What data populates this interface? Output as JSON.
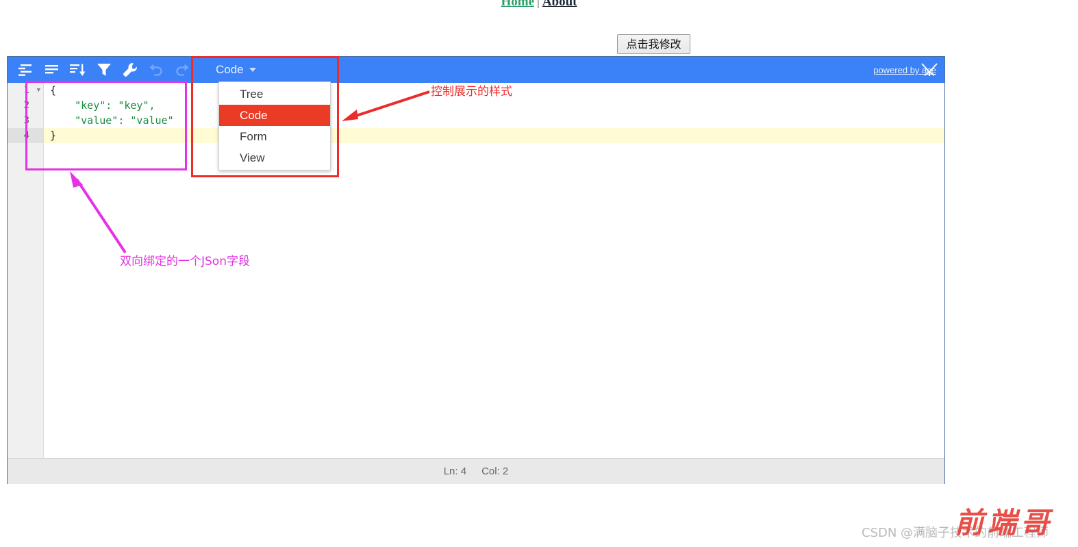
{
  "page_nav": {
    "home_label": "Home",
    "separator": "|",
    "about_label": "About",
    "home_color": "#2e9e6b",
    "about_color": "#1b2733"
  },
  "modify_button": {
    "label": "点击我修改"
  },
  "editor": {
    "toolbar": {
      "background_color": "#3b81f7",
      "buttons": [
        {
          "name": "expand-all-icon",
          "title": "Expand all"
        },
        {
          "name": "collapse-all-icon",
          "title": "Collapse all"
        },
        {
          "name": "sort-icon",
          "title": "Sort"
        },
        {
          "name": "filter-icon",
          "title": "Filter"
        },
        {
          "name": "transform-wrench-icon",
          "title": "Transform"
        },
        {
          "name": "undo-icon",
          "title": "Undo",
          "disabled": true
        },
        {
          "name": "redo-icon",
          "title": "Redo",
          "disabled": true
        }
      ],
      "mode_selector": {
        "current": "Code",
        "caret_icon": "chevron-down-icon",
        "options": [
          "Tree",
          "Code",
          "Form",
          "View"
        ],
        "selected_index": 1,
        "selected_background": "#ea3b24"
      },
      "powered_by": "powered by ace",
      "ace_logo_icon": "ace-logo-icon"
    },
    "code": {
      "lines": [
        {
          "number": "1",
          "foldable": true,
          "active": false,
          "text": "{"
        },
        {
          "number": "2",
          "foldable": false,
          "active": false,
          "text": "    \"key\": \"key\","
        },
        {
          "number": "3",
          "foldable": false,
          "active": false,
          "text": "    \"value\": \"value\""
        },
        {
          "number": "4",
          "foldable": false,
          "active": true,
          "text": "}"
        }
      ],
      "active_line_color": "#fffbd5",
      "string_color": "#1b8a3e"
    },
    "statusbar": {
      "line_label": "Ln: 4",
      "col_label": "Col: 2"
    }
  },
  "annotations": {
    "red": {
      "text": "控制展示的样式",
      "color": "#ec2b2b"
    },
    "pink": {
      "text": "双向绑定的一个JSon字段",
      "color": "#e432e4"
    }
  },
  "watermark": {
    "text": "CSDN @满脑子技术的前端工程师",
    "stamp": "前端哥",
    "stamp_color": "#e8413a"
  }
}
